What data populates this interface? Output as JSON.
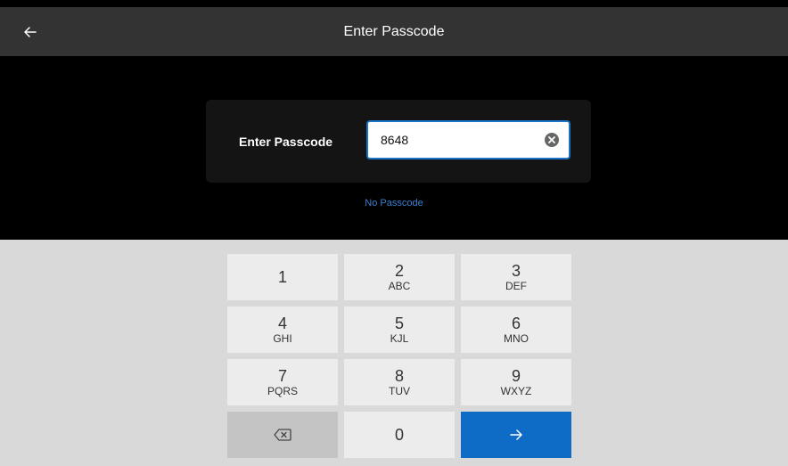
{
  "header": {
    "title": "Enter Passcode",
    "back_icon": "arrow-left-icon"
  },
  "form": {
    "label": "Enter Passcode",
    "input_value": "8648",
    "clear_icon": "clear-circle-icon"
  },
  "link": {
    "no_passcode": "No Passcode"
  },
  "keypad": {
    "keys": [
      {
        "num": "1",
        "letters": ""
      },
      {
        "num": "2",
        "letters": "ABC"
      },
      {
        "num": "3",
        "letters": "DEF"
      },
      {
        "num": "4",
        "letters": "GHI"
      },
      {
        "num": "5",
        "letters": "KJL"
      },
      {
        "num": "6",
        "letters": "MNO"
      },
      {
        "num": "7",
        "letters": "PQRS"
      },
      {
        "num": "8",
        "letters": "TUV"
      },
      {
        "num": "9",
        "letters": "WXYZ"
      },
      {
        "num": "0",
        "letters": ""
      }
    ],
    "backspace_icon": "backspace-icon",
    "submit_icon": "arrow-right-icon"
  },
  "colors": {
    "accent": "#0e6bc6",
    "topbar": "#333333",
    "keypad_bg": "#d9d9d9"
  }
}
